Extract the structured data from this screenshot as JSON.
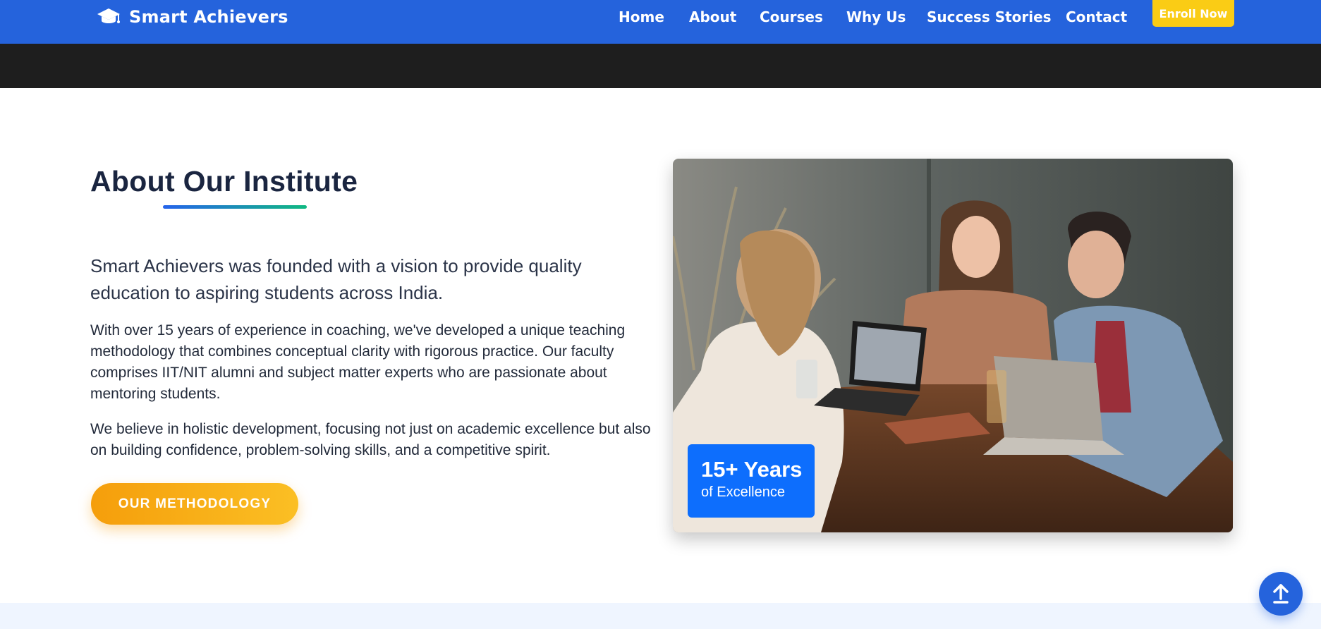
{
  "header": {
    "brand_name": "Smart Achievers",
    "brand_icon": "graduation-cap-icon",
    "nav": [
      {
        "label": "Home"
      },
      {
        "label": "About"
      },
      {
        "label": "Courses"
      },
      {
        "label": "Why Us"
      },
      {
        "label": "Success Stories"
      },
      {
        "label": "Contact"
      }
    ],
    "enroll_label": "Enroll Now"
  },
  "about": {
    "title": "About Our Institute",
    "lead": "Smart Achievers was founded with a vision to provide quality education to aspiring students across India.",
    "paragraphs": [
      "With over 15 years of experience in coaching, we've developed a unique teaching methodology that combines conceptual clarity with rigorous practice. Our faculty comprises IIT/NIT alumni and subject matter experts who are passionate about mentoring students.",
      "We believe in holistic development, focusing not just on academic excellence but also on building confidence, problem-solving skills, and a competitive spirit."
    ],
    "button_label": "OUR METHODOLOGY",
    "badge": {
      "big": "15+ Years",
      "small": "of Excellence"
    }
  },
  "scroll_top_icon": "arrow-up-icon",
  "colors": {
    "primary": "#2563dc",
    "accent": "#facc15",
    "badge": "#0d6efd",
    "dark_band": "#1e1e1e"
  }
}
